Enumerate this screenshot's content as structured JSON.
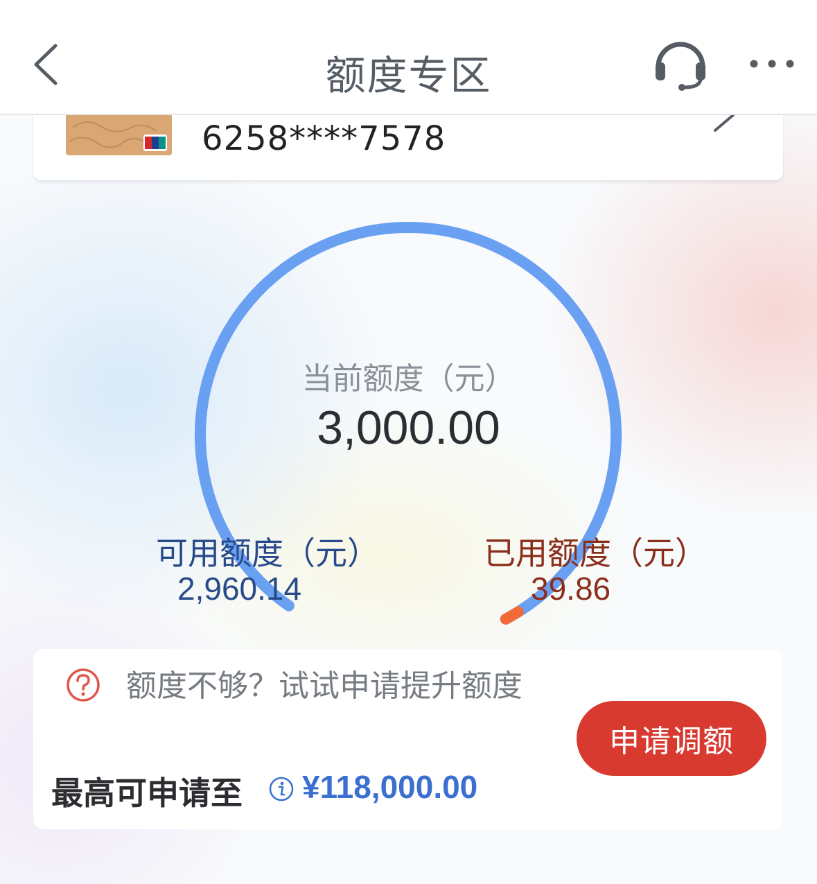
{
  "nav": {
    "title": "额度专区",
    "back_icon": "chevron-left-icon",
    "service_icon": "headset-icon",
    "more_icon": "more-dots-icon"
  },
  "card": {
    "number": "6258****7578",
    "thumbnail_icon": "bank-card-icon",
    "chevron_icon": "chevron-right-icon"
  },
  "gauge": {
    "label": "当前额度（元）",
    "value": "3,000.00",
    "total": 3000.0,
    "used": 39.86,
    "colors": {
      "track": "#6aa0f2",
      "used": "#f06a3a"
    }
  },
  "available": {
    "label": "可用额度（元）",
    "value": "2,960.14"
  },
  "used": {
    "label": "已用额度（元）",
    "value": "39.86"
  },
  "apply": {
    "help_icon": "question-circle-icon",
    "hint": "额度不够？试试申请提升额度",
    "max_label": "最高可申请至",
    "info_icon": "info-icon",
    "max_amount": "¥118,000.00",
    "button_label": "申请调额"
  },
  "colors": {
    "accent_red": "#d83a30",
    "available_blue": "#284a8a",
    "used_brown": "#8a2e1c",
    "amount_blue": "#3b6fd0"
  }
}
